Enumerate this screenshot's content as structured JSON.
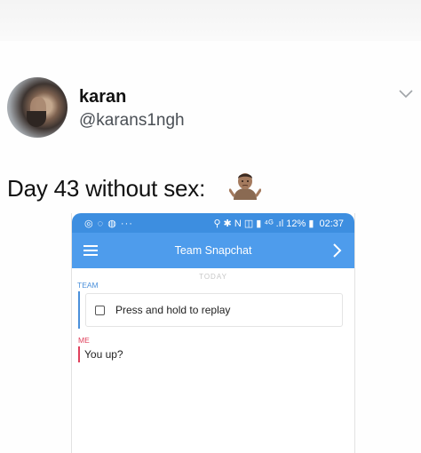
{
  "tweet": {
    "display_name": "karan",
    "handle": "@karans1ngh",
    "text": "Day 43 without sex:",
    "emoji": "person-shrugging-emoji"
  },
  "screenshot": {
    "status_bar": {
      "left_icons": "◎ ◌ ◍ ···",
      "right_icons": "⚲ ✱ N ◫ ▮ ⁴ᴳ .ıl",
      "battery": "12%",
      "time": "02:37"
    },
    "app_bar": {
      "title": "Team Snapchat"
    },
    "day_label": "TODAY",
    "messages": [
      {
        "sender": "TEAM",
        "text": "Press and hold to replay",
        "color": "#4b90db"
      },
      {
        "sender": "ME",
        "text": "You up?",
        "color": "#e0415c"
      }
    ]
  },
  "colors": {
    "status_bar": "#3d8ee0",
    "app_bar": "#4e9cec"
  }
}
